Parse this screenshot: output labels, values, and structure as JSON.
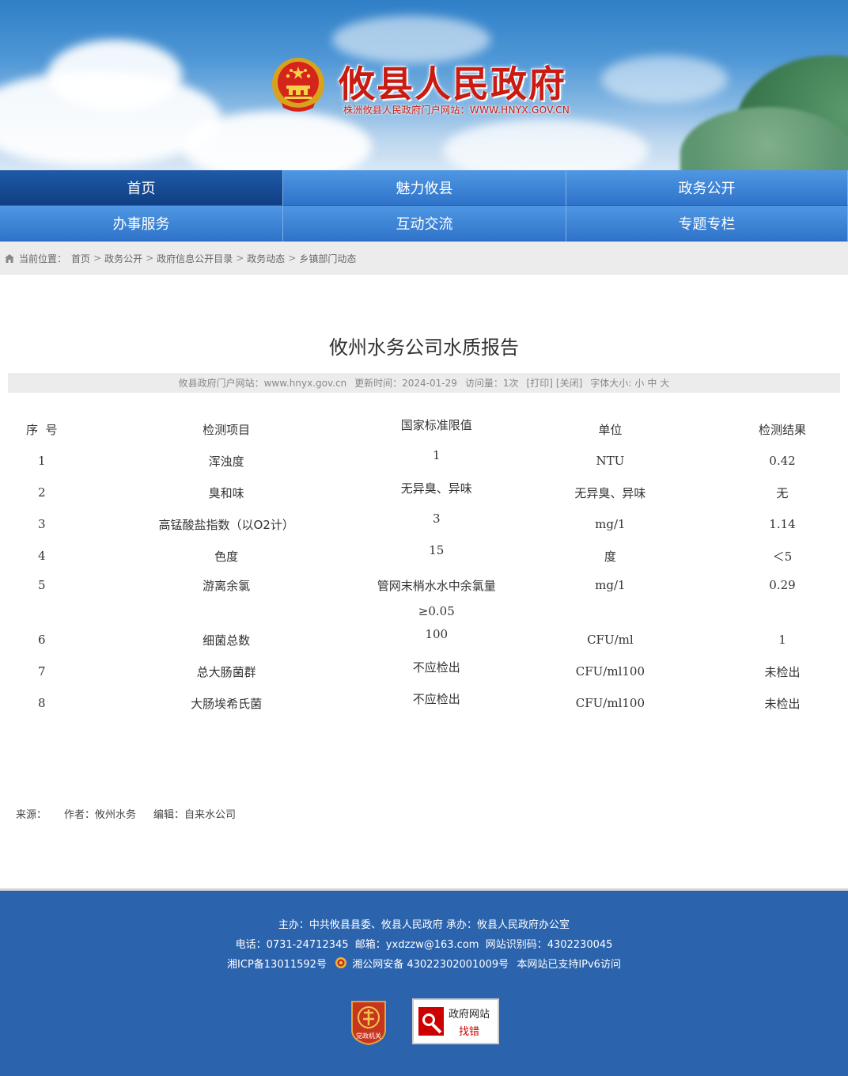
{
  "header": {
    "site_title": "攸县人民政府",
    "site_subtitle": "株洲攸县人民政府门户网站：WWW.HNYX.GOV.CN"
  },
  "nav": {
    "items": [
      {
        "label": "首页",
        "active": true
      },
      {
        "label": "魅力攸县"
      },
      {
        "label": "政务公开"
      },
      {
        "label": "办事服务"
      },
      {
        "label": "互动交流"
      },
      {
        "label": "专题专栏"
      }
    ]
  },
  "breadcrumb": {
    "prefix": "当前位置：",
    "items": [
      "首页",
      "政务公开",
      "政府信息公开目录",
      "政务动态",
      "乡镇部门动态"
    ],
    "separator": ">"
  },
  "article": {
    "title": "攸州水务公司水质报告",
    "meta": {
      "site": "攸县政府门户网站：www.hnyx.gov.cn",
      "updated": "更新时间：2024-01-29",
      "visits": "访问量：1次",
      "print": "[打印]",
      "close": "[关闭]",
      "font_label": "字体大小:",
      "font_small": "小",
      "font_medium": "中",
      "font_large": "大"
    },
    "table": {
      "headers": [
        "序  号",
        "检测项目",
        "国家标准限值",
        "单位",
        "检测结果"
      ],
      "rows": [
        [
          "1",
          "浑浊度",
          "1",
          "NTU",
          "0.42"
        ],
        [
          "2",
          "臭和味",
          "无异臭、异味",
          "无异臭、异味",
          "无"
        ],
        [
          "3",
          "高锰酸盐指数（以O2计）",
          "3",
          "mg/1",
          "1.14"
        ],
        [
          "4",
          "色度",
          "15",
          "度",
          "＜5"
        ],
        [
          "5",
          "游离余氯",
          "管网末梢水水中余氯量",
          "mg/1",
          "0.29"
        ],
        [
          "",
          "",
          "≥0.05",
          "",
          ""
        ],
        [
          "6",
          "细菌总数",
          "100",
          "CFU/ml",
          "1"
        ],
        [
          "7",
          "总大肠菌群",
          "不应检出",
          "CFU/ml100",
          "未检出"
        ],
        [
          "8",
          "大肠埃希氏菌",
          "不应检出",
          "CFU/ml100",
          "未检出"
        ]
      ]
    },
    "source": {
      "source_label": "来源：",
      "author": "作者：攸州水务",
      "editor": "编辑：自来水公司"
    }
  },
  "footer": {
    "line1": "主办：中共攸县县委、攸县人民政府 承办：攸县人民政府办公室",
    "line2": "电话：0731-24712345  邮箱：yxdzzw@163.com  网站识别码：4302230045",
    "icp": "湘ICP备13011592号",
    "police": "湘公网安备 43022302001009号",
    "ipv6": "本网站已支持IPv6访问",
    "badge_text": "党政机关",
    "jiucuo_line1": "政府网站",
    "jiucuo_line2": "找错"
  },
  "colors": {
    "title_red": "#c91b12",
    "nav_blue": "#2f73c9",
    "nav_active": "#0f3f82",
    "footer_blue": "#2b63ad"
  }
}
